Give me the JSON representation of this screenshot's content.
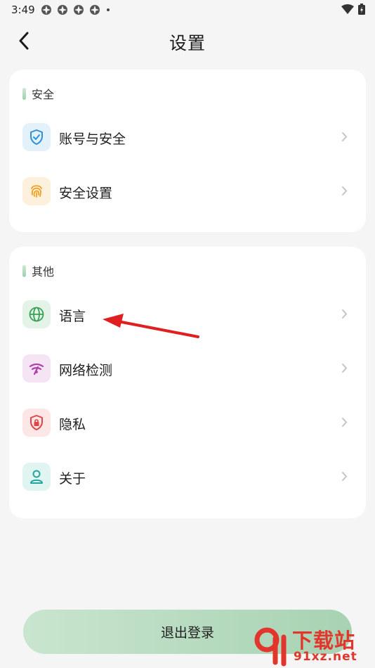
{
  "status_bar": {
    "time": "3:49"
  },
  "header": {
    "title": "设置"
  },
  "sections": [
    {
      "label": "安全",
      "items": [
        {
          "label": "账号与安全",
          "icon": "shield-check-icon"
        },
        {
          "label": "安全设置",
          "icon": "fingerprint-icon"
        }
      ]
    },
    {
      "label": "其他",
      "items": [
        {
          "label": "语言",
          "icon": "globe-icon"
        },
        {
          "label": "网络检测",
          "icon": "wifi-signal-icon"
        },
        {
          "label": "隐私",
          "icon": "privacy-lock-icon"
        },
        {
          "label": "关于",
          "icon": "person-icon"
        }
      ]
    }
  ],
  "logout": {
    "label": "退出登录"
  },
  "watermark": {
    "top": "下载站",
    "bottom": "91xz.net"
  },
  "colors": {
    "accent_green": "#a7d2b2",
    "arrow_red": "#e02020",
    "watermark_red": "#e2362c"
  }
}
